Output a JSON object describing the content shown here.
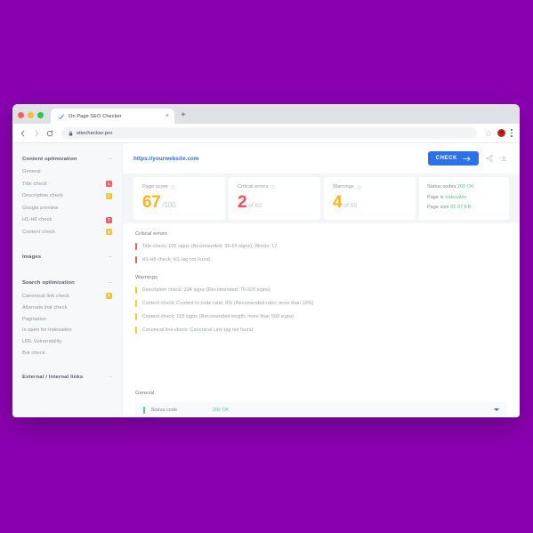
{
  "browser": {
    "tab": {
      "title": "On Page SEO Checker",
      "favicon": "checkmark-favicon",
      "close": "×"
    },
    "new_tab": "+",
    "nav": {
      "back": "←",
      "forward": "→",
      "reload": "⟳"
    },
    "omnibox": {
      "value": "sitechecker.pro",
      "lock": "lock-icon"
    }
  },
  "sidebar": {
    "groups": [
      {
        "title": "Content optimization",
        "collapse": "–",
        "items": [
          {
            "label": "General",
            "badge": null,
            "badge_color": null
          },
          {
            "label": "Title check",
            "badge": "1",
            "badge_color": "red"
          },
          {
            "label": "Description check",
            "badge": "1",
            "badge_color": "yellow"
          },
          {
            "label": "Google preview",
            "badge": null,
            "badge_color": null
          },
          {
            "label": "H1-H6 check",
            "badge": "1",
            "badge_color": "red"
          },
          {
            "label": "Content check",
            "badge": "2",
            "badge_color": "yellow"
          }
        ]
      },
      {
        "title": "Images",
        "collapse": "–",
        "items": []
      },
      {
        "title": "Search optimization",
        "collapse": "–",
        "items": [
          {
            "label": "Canonical link check",
            "badge": "1",
            "badge_color": "yellow"
          },
          {
            "label": "Alternate link check",
            "badge": null,
            "badge_color": null
          },
          {
            "label": "Pagination",
            "badge": null,
            "badge_color": null
          },
          {
            "label": "Is open for indexation",
            "badge": null,
            "badge_color": null
          },
          {
            "label": "URL Vulnerability",
            "badge": null,
            "badge_color": null
          },
          {
            "label": "Bot check",
            "badge": null,
            "badge_color": null
          }
        ]
      },
      {
        "title": "External / Internal links",
        "collapse": "–",
        "items": []
      }
    ]
  },
  "header": {
    "url": "https://yourwebsite.com",
    "check_button": "CHECK",
    "check_arrow": "→",
    "share_icon": "share-icon",
    "download_icon": "download-icon"
  },
  "cards": {
    "page_score": {
      "title": "Page score",
      "value": "67",
      "suffix": "/100"
    },
    "critical_errors": {
      "title": "Critical errors",
      "value": "2",
      "suffix": "of 60"
    },
    "warnings": {
      "title": "Warnings",
      "value": "4",
      "suffix": "of 60"
    },
    "status": {
      "lines": [
        {
          "label": "Status codes",
          "value": "200 OK"
        },
        {
          "label": "Page is",
          "value": "Indexable"
        },
        {
          "label": "Page size",
          "value": "82.97 KB"
        }
      ]
    }
  },
  "critical_errors": {
    "title": "Critical errors",
    "items": [
      "Title check: 105 signs (Recomended: 35-65 signs), Words: 17",
      "H1-H6 check: H1 tag not found"
    ]
  },
  "warnings": {
    "title": "Warnings",
    "items": [
      "Description check: 334 signs (Recomended: 70-320 signs)",
      "Content check: Content to code ratio: 8% (Recomended ratio: more than 10%)",
      "Content check: 153 signs (Recomended length: more than 500 signs)",
      "Canonical link check: Canonical Link tag not found"
    ]
  },
  "general": {
    "title": "General",
    "row": {
      "label": "Status code",
      "value": "200 OK",
      "expand_icon": "chevron-down-icon"
    }
  },
  "colors": {
    "background": "#8a00b0",
    "accent_blue": "#2b72e8",
    "score_orange": "#fdb416",
    "error_red": "#fb4a59",
    "warning_yellow": "#ffc230",
    "success_green": "#5cc98c"
  }
}
